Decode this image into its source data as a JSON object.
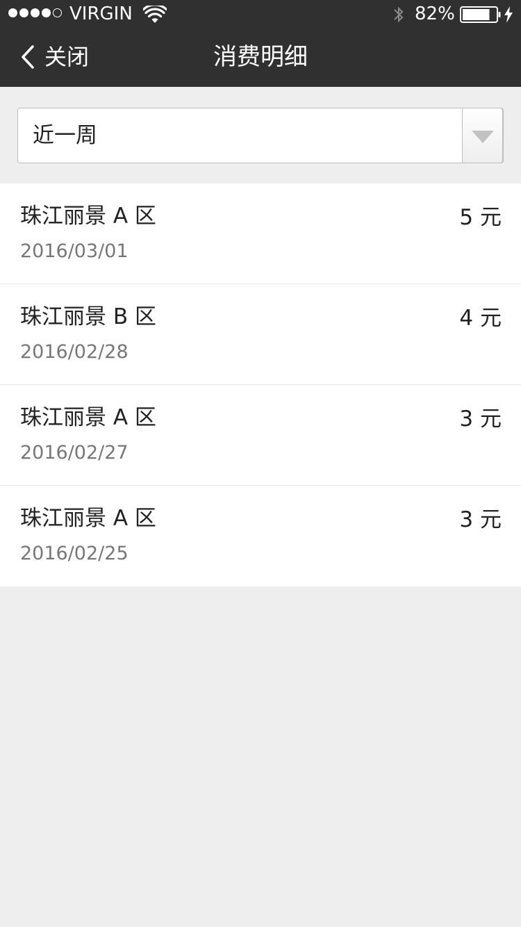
{
  "status_bar": {
    "carrier": "VIRGIN",
    "signal_dots": [
      true,
      true,
      true,
      true,
      false
    ],
    "battery_percent": "82%",
    "battery_level": 0.82
  },
  "nav": {
    "back_label": "关闭",
    "title": "消费明细"
  },
  "filter": {
    "selected": "近一周"
  },
  "records": [
    {
      "place": "珠江丽景 A 区",
      "date": "2016/03/01",
      "amount": "5 元"
    },
    {
      "place": "珠江丽景 B 区",
      "date": "2016/02/28",
      "amount": "4 元"
    },
    {
      "place": "珠江丽景 A 区",
      "date": "2016/02/27",
      "amount": "3 元"
    },
    {
      "place": "珠江丽景 A 区",
      "date": "2016/02/25",
      "amount": "3 元"
    }
  ],
  "colors": {
    "nav_bg": "#303030",
    "page_bg": "#eeeeee",
    "row_bg": "#ffffff"
  }
}
